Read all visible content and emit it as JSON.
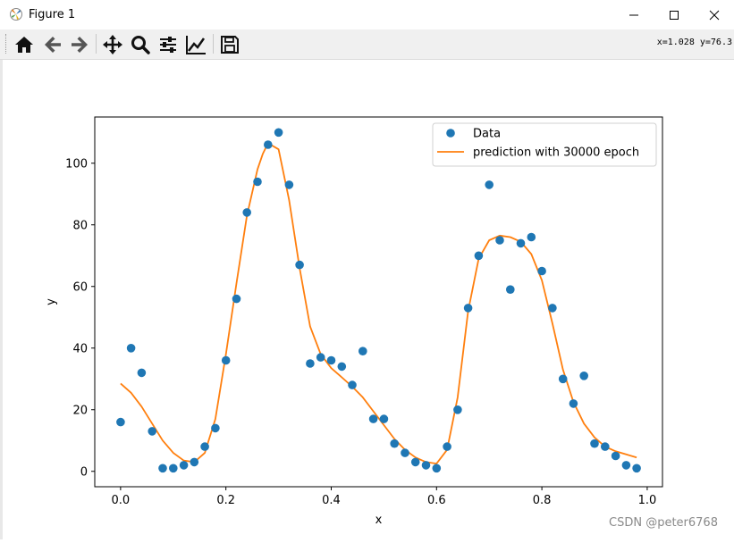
{
  "window": {
    "title": "Figure 1",
    "minimize_icon": "minimize-icon",
    "maximize_icon": "maximize-icon",
    "close_icon": "close-icon"
  },
  "toolbar": {
    "icons": [
      "home-icon",
      "back-arrow-icon",
      "forward-arrow-icon",
      "pan-icon",
      "zoom-icon",
      "subplots-icon",
      "edit-axes-icon",
      "save-icon"
    ],
    "coords_text": "x=1.028 y=76.3"
  },
  "watermark": "CSDN @peter6768",
  "colors": {
    "data": "#1f77b4",
    "prediction": "#ff7f0e"
  },
  "chart_data": {
    "type": "scatter",
    "xlabel": "x",
    "ylabel": "y",
    "xlim": [
      -0.049,
      1.029
    ],
    "ylim": [
      -5,
      115
    ],
    "xticks": [
      0.0,
      0.2,
      0.4,
      0.6,
      0.8,
      1.0
    ],
    "xtick_labels": [
      "0.0",
      "0.2",
      "0.4",
      "0.6",
      "0.8",
      "1.0"
    ],
    "yticks": [
      0,
      20,
      40,
      60,
      80,
      100
    ],
    "ytick_labels": [
      "0",
      "20",
      "40",
      "60",
      "80",
      "100"
    ],
    "grid": false,
    "legend": "top-right",
    "series": [
      {
        "name": "Data",
        "kind": "scatter",
        "x": [
          0.0,
          0.02,
          0.04,
          0.06,
          0.08,
          0.1,
          0.12,
          0.14,
          0.16,
          0.18,
          0.2,
          0.22,
          0.24,
          0.26,
          0.28,
          0.3,
          0.32,
          0.34,
          0.36,
          0.38,
          0.4,
          0.42,
          0.44,
          0.46,
          0.48,
          0.5,
          0.52,
          0.54,
          0.56,
          0.58,
          0.6,
          0.62,
          0.64,
          0.66,
          0.68,
          0.7,
          0.72,
          0.74,
          0.76,
          0.78,
          0.8,
          0.82,
          0.84,
          0.86,
          0.88,
          0.9,
          0.92,
          0.94,
          0.96,
          0.98
        ],
        "y": [
          16,
          40,
          32,
          13,
          1,
          1,
          2,
          3,
          8,
          14,
          36,
          56,
          84,
          94,
          106,
          110,
          93,
          67,
          35,
          37,
          36,
          34,
          28,
          39,
          17,
          17,
          9,
          6,
          3,
          2,
          1,
          8,
          20,
          53,
          70,
          93,
          75,
          59,
          74,
          76,
          65,
          53,
          30,
          22,
          31,
          9,
          8,
          5,
          2,
          1
        ]
      },
      {
        "name": "prediction with 30000 epoch",
        "kind": "line",
        "x": [
          0.0,
          0.02,
          0.04,
          0.06,
          0.08,
          0.1,
          0.12,
          0.14,
          0.16,
          0.18,
          0.2,
          0.22,
          0.24,
          0.26,
          0.27,
          0.28,
          0.3,
          0.32,
          0.34,
          0.36,
          0.38,
          0.4,
          0.42,
          0.44,
          0.46,
          0.48,
          0.5,
          0.52,
          0.54,
          0.56,
          0.58,
          0.6,
          0.62,
          0.64,
          0.66,
          0.68,
          0.7,
          0.72,
          0.74,
          0.76,
          0.78,
          0.8,
          0.82,
          0.84,
          0.86,
          0.88,
          0.9,
          0.92,
          0.94,
          0.96,
          0.98
        ],
        "y": [
          28.5,
          25.5,
          21,
          15.5,
          10,
          6,
          3.5,
          3,
          6,
          17,
          38,
          61,
          83,
          98,
          103,
          106.5,
          104.5,
          88,
          66,
          47,
          38,
          33.5,
          30.5,
          27.5,
          24,
          19.5,
          15,
          10.5,
          7,
          4.5,
          3,
          2.5,
          7,
          24,
          52,
          69,
          75,
          76.5,
          76,
          74.5,
          70.5,
          62,
          48,
          33,
          22.5,
          15.5,
          11,
          8,
          6.5,
          5.5,
          4.5
        ]
      }
    ]
  }
}
